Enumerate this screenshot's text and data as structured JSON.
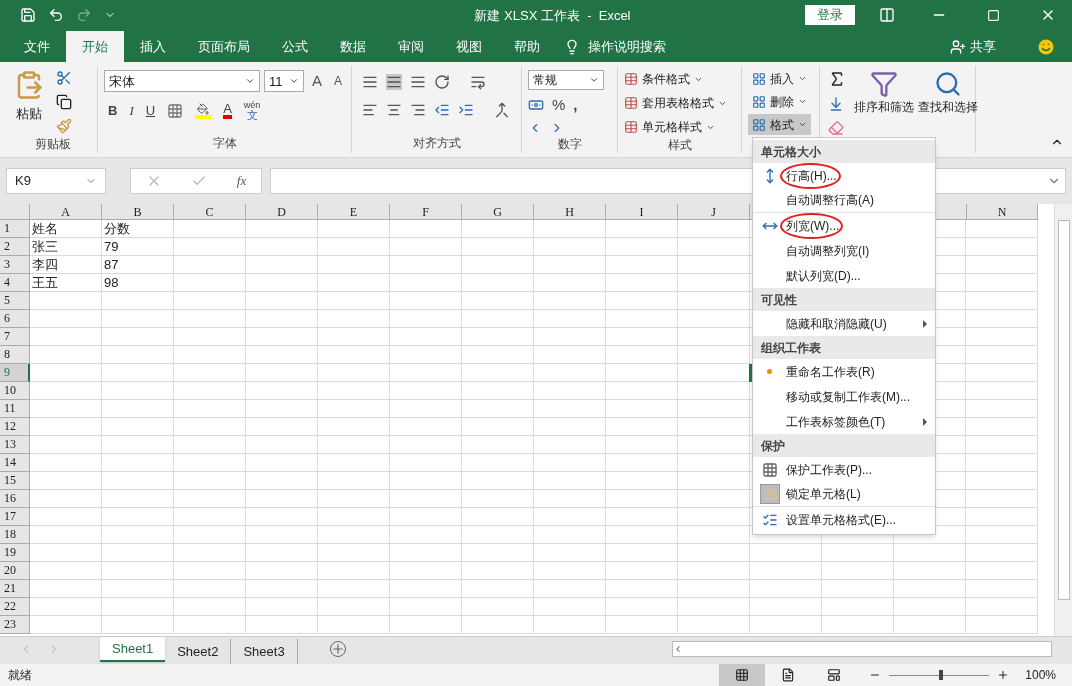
{
  "title_bar": {
    "title": "新建 XLSX 工作表  -  Excel",
    "login": "登录"
  },
  "ribbon_tabs": [
    {
      "label": "文件",
      "selected": false
    },
    {
      "label": "开始",
      "selected": true
    },
    {
      "label": "插入",
      "selected": false
    },
    {
      "label": "页面布局",
      "selected": false
    },
    {
      "label": "公式",
      "selected": false
    },
    {
      "label": "数据",
      "selected": false
    },
    {
      "label": "审阅",
      "selected": false
    },
    {
      "label": "视图",
      "selected": false
    },
    {
      "label": "帮助",
      "selected": false
    }
  ],
  "tell_me": "操作说明搜索",
  "share": "共享",
  "clipboard": {
    "paste": "粘贴",
    "label": "剪贴板"
  },
  "font": {
    "name": "宋体",
    "size": "11",
    "grow": "A",
    "shrink": "A",
    "bold": "B",
    "italic": "I",
    "underline": "U",
    "font_color": "A",
    "phonetic_top": "wén",
    "phonetic_bottom": "文",
    "label": "字体"
  },
  "alignment": {
    "label": "对齐方式"
  },
  "number": {
    "format": "常规",
    "percent": "%",
    "comma": ",",
    "label": "数字"
  },
  "styles": {
    "items": [
      "条件格式",
      "套用表格格式",
      "单元格样式"
    ],
    "label": "样式"
  },
  "cells": {
    "items": [
      {
        "label": "插入",
        "pressed": false
      },
      {
        "label": "删除",
        "pressed": false
      },
      {
        "label": "格式",
        "pressed": true
      }
    ]
  },
  "editing": {
    "sort": "排序和筛选",
    "find": "查找和选择"
  },
  "formula_bar": {
    "name_box": "K9",
    "fx": "fx"
  },
  "columns": [
    "A",
    "B",
    "C",
    "D",
    "E",
    "F",
    "G",
    "H",
    "I",
    "J"
  ],
  "columns_right": [
    "N"
  ],
  "rows": [
    {
      "label": "1",
      "selected": false
    },
    {
      "label": "2",
      "selected": false
    },
    {
      "label": "3",
      "selected": false
    },
    {
      "label": "4",
      "selected": false
    },
    {
      "label": "5",
      "selected": false
    },
    {
      "label": "6",
      "selected": false
    },
    {
      "label": "7",
      "selected": false
    },
    {
      "label": "8",
      "selected": false
    },
    {
      "label": "9",
      "selected": true
    },
    {
      "label": "10",
      "selected": false
    },
    {
      "label": "11",
      "selected": false
    },
    {
      "label": "12",
      "selected": false
    },
    {
      "label": "13",
      "selected": false
    },
    {
      "label": "14",
      "selected": false
    },
    {
      "label": "15",
      "selected": false
    },
    {
      "label": "16",
      "selected": false
    },
    {
      "label": "17",
      "selected": false
    },
    {
      "label": "18",
      "selected": false
    },
    {
      "label": "19",
      "selected": false
    },
    {
      "label": "20",
      "selected": false
    },
    {
      "label": "21",
      "selected": false
    },
    {
      "label": "22",
      "selected": false
    },
    {
      "label": "23",
      "selected": false
    }
  ],
  "cells_data": [
    [
      "姓名",
      "分数"
    ],
    [
      "张三",
      "79"
    ],
    [
      "李四",
      "87"
    ],
    [
      "王五",
      "98"
    ]
  ],
  "menu": [
    {
      "header": "单元格大小",
      "items": [
        {
          "label": "行高(H)...",
          "kind": "row-height",
          "circled": true,
          "submenu": false,
          "bullet": false,
          "divider_after": false
        },
        {
          "label": "自动调整行高(A)",
          "kind": "plain",
          "circled": false,
          "submenu": false,
          "bullet": false,
          "divider_after": true
        },
        {
          "label": "列宽(W)...",
          "kind": "column-width",
          "circled": true,
          "submenu": false,
          "bullet": false,
          "divider_after": false
        },
        {
          "label": "自动调整列宽(I)",
          "kind": "plain",
          "circled": false,
          "submenu": false,
          "bullet": false,
          "divider_after": false
        },
        {
          "label": "默认列宽(D)...",
          "kind": "plain",
          "circled": false,
          "submenu": false,
          "bullet": false,
          "divider_after": false
        }
      ]
    },
    {
      "header": "可见性",
      "items": [
        {
          "label": "隐藏和取消隐藏(U)",
          "kind": "plain",
          "circled": false,
          "submenu": true,
          "bullet": false,
          "divider_after": false
        }
      ]
    },
    {
      "header": "组织工作表",
      "items": [
        {
          "label": "重命名工作表(R)",
          "kind": "plain",
          "circled": false,
          "submenu": false,
          "bullet": true,
          "divider_after": false
        },
        {
          "label": "移动或复制工作表(M)...",
          "kind": "plain",
          "circled": false,
          "submenu": false,
          "bullet": false,
          "divider_after": false
        },
        {
          "label": "工作表标签颜色(T)",
          "kind": "plain",
          "circled": false,
          "submenu": true,
          "bullet": false,
          "divider_after": false
        }
      ]
    },
    {
      "header": "保护",
      "items": [
        {
          "label": "保护工作表(P)...",
          "kind": "protect-sheet",
          "circled": false,
          "submenu": false,
          "bullet": false,
          "divider_after": false
        },
        {
          "label": "锁定单元格(L)",
          "kind": "lock",
          "circled": false,
          "submenu": false,
          "bullet": false,
          "divider_after": true
        },
        {
          "label": "设置单元格格式(E)...",
          "kind": "format-cells",
          "circled": false,
          "submenu": false,
          "bullet": false,
          "divider_after": false
        }
      ]
    }
  ],
  "sheets": [
    {
      "label": "Sheet1",
      "selected": true
    },
    {
      "label": "Sheet2",
      "selected": false
    },
    {
      "label": "Sheet3",
      "selected": false
    }
  ],
  "status": {
    "text": "就绪",
    "views": [
      {
        "kind": "normal",
        "selected": true
      },
      {
        "kind": "page-layout",
        "selected": false
      },
      {
        "kind": "page-break",
        "selected": false
      }
    ],
    "zoom": {
      "level": 0.5
    },
    "zoom_text": "100%"
  }
}
